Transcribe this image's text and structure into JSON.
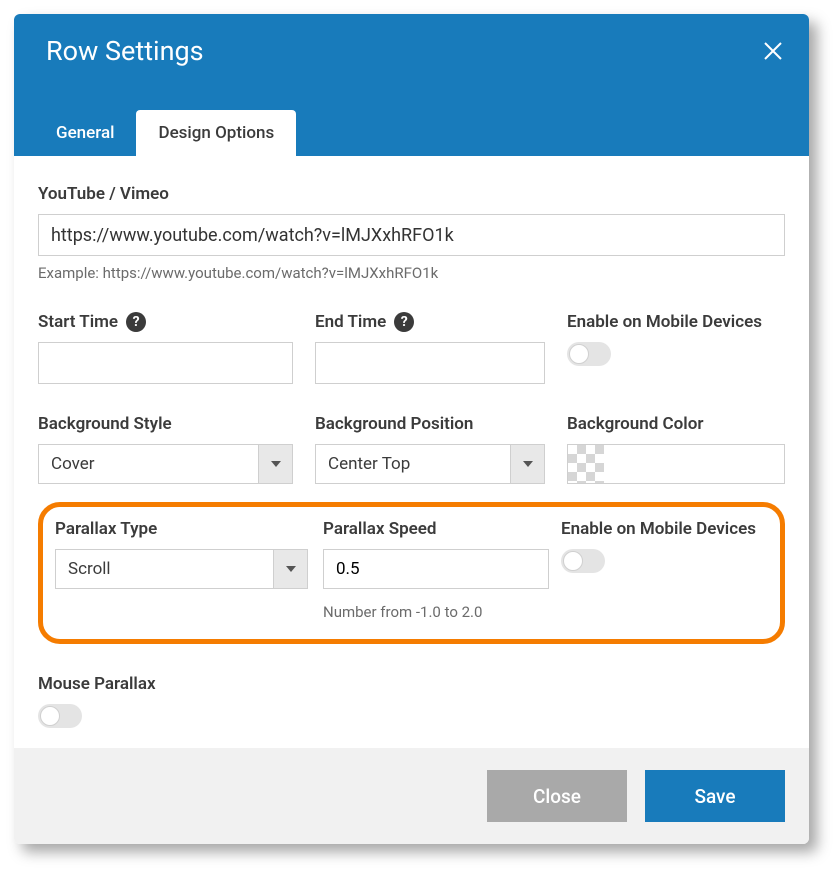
{
  "header": {
    "title": "Row Settings"
  },
  "tabs": {
    "general": "General",
    "design": "Design Options"
  },
  "video": {
    "label": "YouTube / Vimeo",
    "value": "https://www.youtube.com/watch?v=lMJXxhRFO1k",
    "hint": "Example: https://www.youtube.com/watch?v=lMJXxhRFO1k"
  },
  "start_time": {
    "label": "Start Time",
    "value": ""
  },
  "end_time": {
    "label": "End Time",
    "value": ""
  },
  "mobile1": {
    "label": "Enable on Mobile Devices"
  },
  "bg_style": {
    "label": "Background Style",
    "value": "Cover"
  },
  "bg_position": {
    "label": "Background Position",
    "value": "Center Top"
  },
  "bg_color": {
    "label": "Background Color"
  },
  "parallax_type": {
    "label": "Parallax Type",
    "value": "Scroll"
  },
  "parallax_speed": {
    "label": "Parallax Speed",
    "value": "0.5",
    "hint": "Number from -1.0 to 2.0"
  },
  "mobile2": {
    "label": "Enable on Mobile Devices"
  },
  "mouse": {
    "label": "Mouse Parallax"
  },
  "footer": {
    "close": "Close",
    "save": "Save"
  }
}
